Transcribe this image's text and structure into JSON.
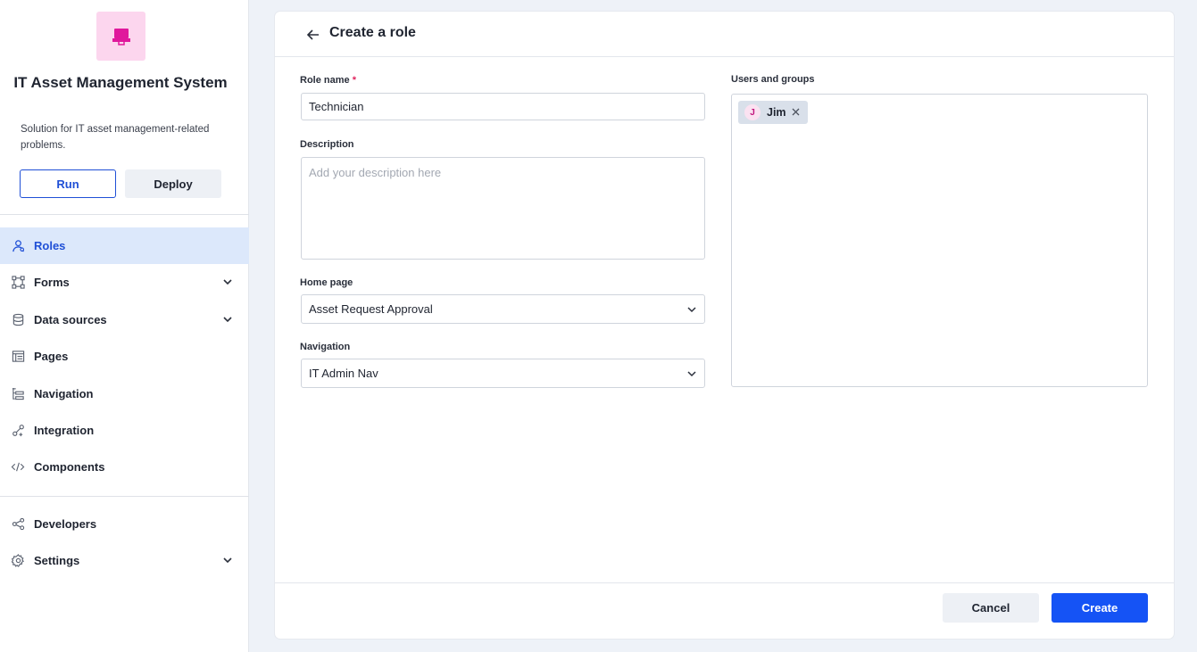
{
  "app": {
    "title": "IT Asset Management System",
    "description": "Solution for IT asset management-related problems.",
    "run_label": "Run",
    "deploy_label": "Deploy",
    "logo_icon": "app-screen-icon",
    "logo_color": "#e0189c"
  },
  "sidebar": {
    "items": [
      {
        "label": "Roles",
        "icon": "roles-icon",
        "active": true,
        "chevron": false
      },
      {
        "label": "Forms",
        "icon": "forms-icon",
        "active": false,
        "chevron": true
      },
      {
        "label": "Data sources",
        "icon": "database-icon",
        "active": false,
        "chevron": true
      },
      {
        "label": "Pages",
        "icon": "pages-icon",
        "active": false,
        "chevron": false
      },
      {
        "label": "Navigation",
        "icon": "navigation-icon",
        "active": false,
        "chevron": false
      },
      {
        "label": "Integration",
        "icon": "integration-icon",
        "active": false,
        "chevron": false
      },
      {
        "label": "Components",
        "icon": "code-icon",
        "active": false,
        "chevron": false
      }
    ],
    "bottom_items": [
      {
        "label": "Developers",
        "icon": "share-icon",
        "chevron": false
      },
      {
        "label": "Settings",
        "icon": "gear-icon",
        "chevron": true
      }
    ]
  },
  "page": {
    "title": "Create a role"
  },
  "form": {
    "role_name_label": "Role name",
    "required_mark": "*",
    "role_name_value": "Technician",
    "description_label": "Description",
    "description_placeholder": "Add your description here",
    "home_page_label": "Home page",
    "home_page_value": "Asset Request Approval",
    "navigation_label": "Navigation",
    "navigation_value": "IT Admin Nav",
    "users_label": "Users and groups",
    "users": [
      {
        "initial": "J",
        "name": "Jim"
      }
    ]
  },
  "footer": {
    "cancel_label": "Cancel",
    "create_label": "Create"
  },
  "colors": {
    "accent": "#1553f5",
    "active_bg": "#dce8fb",
    "logo_bg": "#fcd6ee"
  }
}
